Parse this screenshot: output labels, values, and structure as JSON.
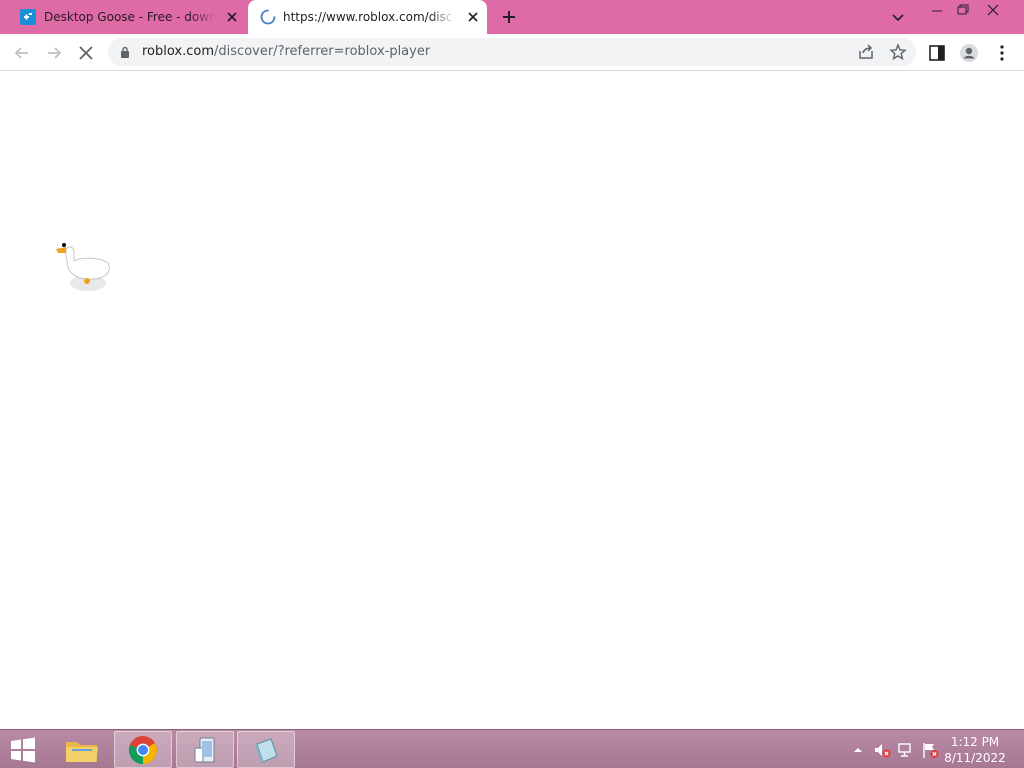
{
  "browser": {
    "tabs": [
      {
        "title": "Desktop Goose - Free - downloa",
        "favicon": "desktop-goose-favicon",
        "active": false
      },
      {
        "title": "https://www.roblox.com/discove",
        "favicon": "loading-spinner-icon",
        "active": true
      }
    ],
    "new_tab_icon": "plus-icon",
    "tab_search_icon": "chevron-down-icon",
    "address": {
      "host": "roblox.com",
      "path": "/discover/?referrer=roblox-player"
    },
    "colors": {
      "tabstrip": "#de6ba6",
      "active_tab": "#ffffff",
      "omnibox": "#f1f3f4"
    }
  },
  "page": {
    "overlay": {
      "name": "desktop-goose",
      "icon": "goose-icon"
    }
  },
  "taskbar": {
    "apps": [
      {
        "name": "file-explorer",
        "icon": "folder-icon",
        "active": false
      },
      {
        "name": "chrome",
        "icon": "chrome-icon",
        "active": true
      },
      {
        "name": "app-3",
        "icon": "device-icon",
        "active": true
      },
      {
        "name": "app-4",
        "icon": "notepad-icon",
        "active": true
      }
    ],
    "clock": {
      "time": "1:12 PM",
      "date": "8/11/2022"
    },
    "color": "#b98aa4"
  }
}
